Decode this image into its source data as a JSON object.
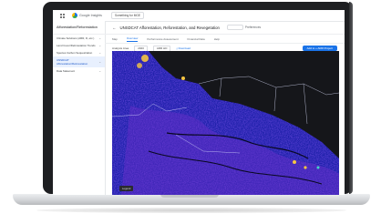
{
  "app": {
    "logo_text": "Google Insights",
    "workspace": "Something for MGE"
  },
  "sidebar": {
    "title": "Afforestation/Reforestation",
    "items": [
      {
        "label": "Climate Solutions (ARR, D, etc.)"
      },
      {
        "label": "Land Cover/Deforestation Trends"
      },
      {
        "label": "Species Carbon Sequestration"
      },
      {
        "label": "UNSDCAT Afforestation/Reforestation",
        "active": true
      },
      {
        "label": "Data Statement"
      }
    ]
  },
  "main": {
    "title": "UNSDCAT Afforestation, Reforestation, and Revegetation",
    "period_label": "Preferences",
    "tabs": [
      {
        "label": "Map"
      },
      {
        "label": "Overview",
        "active": true
      },
      {
        "label": "Performance Assessment"
      },
      {
        "label": "Financial Data"
      },
      {
        "label": "Help"
      }
    ],
    "filters": {
      "area_label": "Analysis Area",
      "year": "2020",
      "unit": "ARR HD",
      "download": "Download",
      "primary_button": "Add to + ARR Project"
    },
    "map": {
      "legend": "Legend",
      "colors": {
        "background": "#15161a",
        "land_low": "#1b1fa8",
        "land_mid": "#3a43d8",
        "land_high": "#6a2fc9",
        "highlight": "#f5c542"
      }
    }
  }
}
